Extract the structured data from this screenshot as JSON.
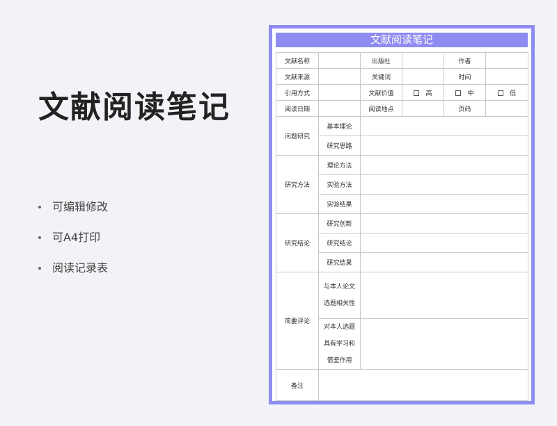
{
  "promo": {
    "title": "文献阅读笔记",
    "features": [
      "可编辑修改",
      "可A4打印",
      "阅读记录表"
    ]
  },
  "document": {
    "header": "文献阅读笔记",
    "info_rows": [
      [
        "文献名称",
        "",
        "出版社",
        "",
        "作者",
        ""
      ],
      [
        "文献来源",
        "",
        "关键词",
        "",
        "时间",
        ""
      ],
      [
        "阅读日期",
        "",
        "阅读地点",
        "",
        "页码",
        ""
      ]
    ],
    "citation_label": "引用方式",
    "value_label": "文献价值",
    "value_options": [
      "高",
      "中",
      "低"
    ],
    "sections": {
      "problem": {
        "label": "问题研究",
        "items": [
          "基本理论",
          "研究思路"
        ]
      },
      "method": {
        "label": "研究方法",
        "items": [
          "理论方法",
          "实验方法",
          "实验结果"
        ]
      },
      "conclusion": {
        "label": "研究结论",
        "items": [
          "研究创新",
          "研究结论",
          "研究结果"
        ]
      },
      "review": {
        "label": "简要评论",
        "item1": [
          "与本人论文",
          "选题相关性"
        ],
        "item2": [
          "对本人选题",
          "具有学习和",
          "借鉴作用"
        ]
      }
    },
    "remarks_label": "备注"
  },
  "colors": {
    "accent": "#8e8cf0",
    "border": "#c9c9c9"
  }
}
